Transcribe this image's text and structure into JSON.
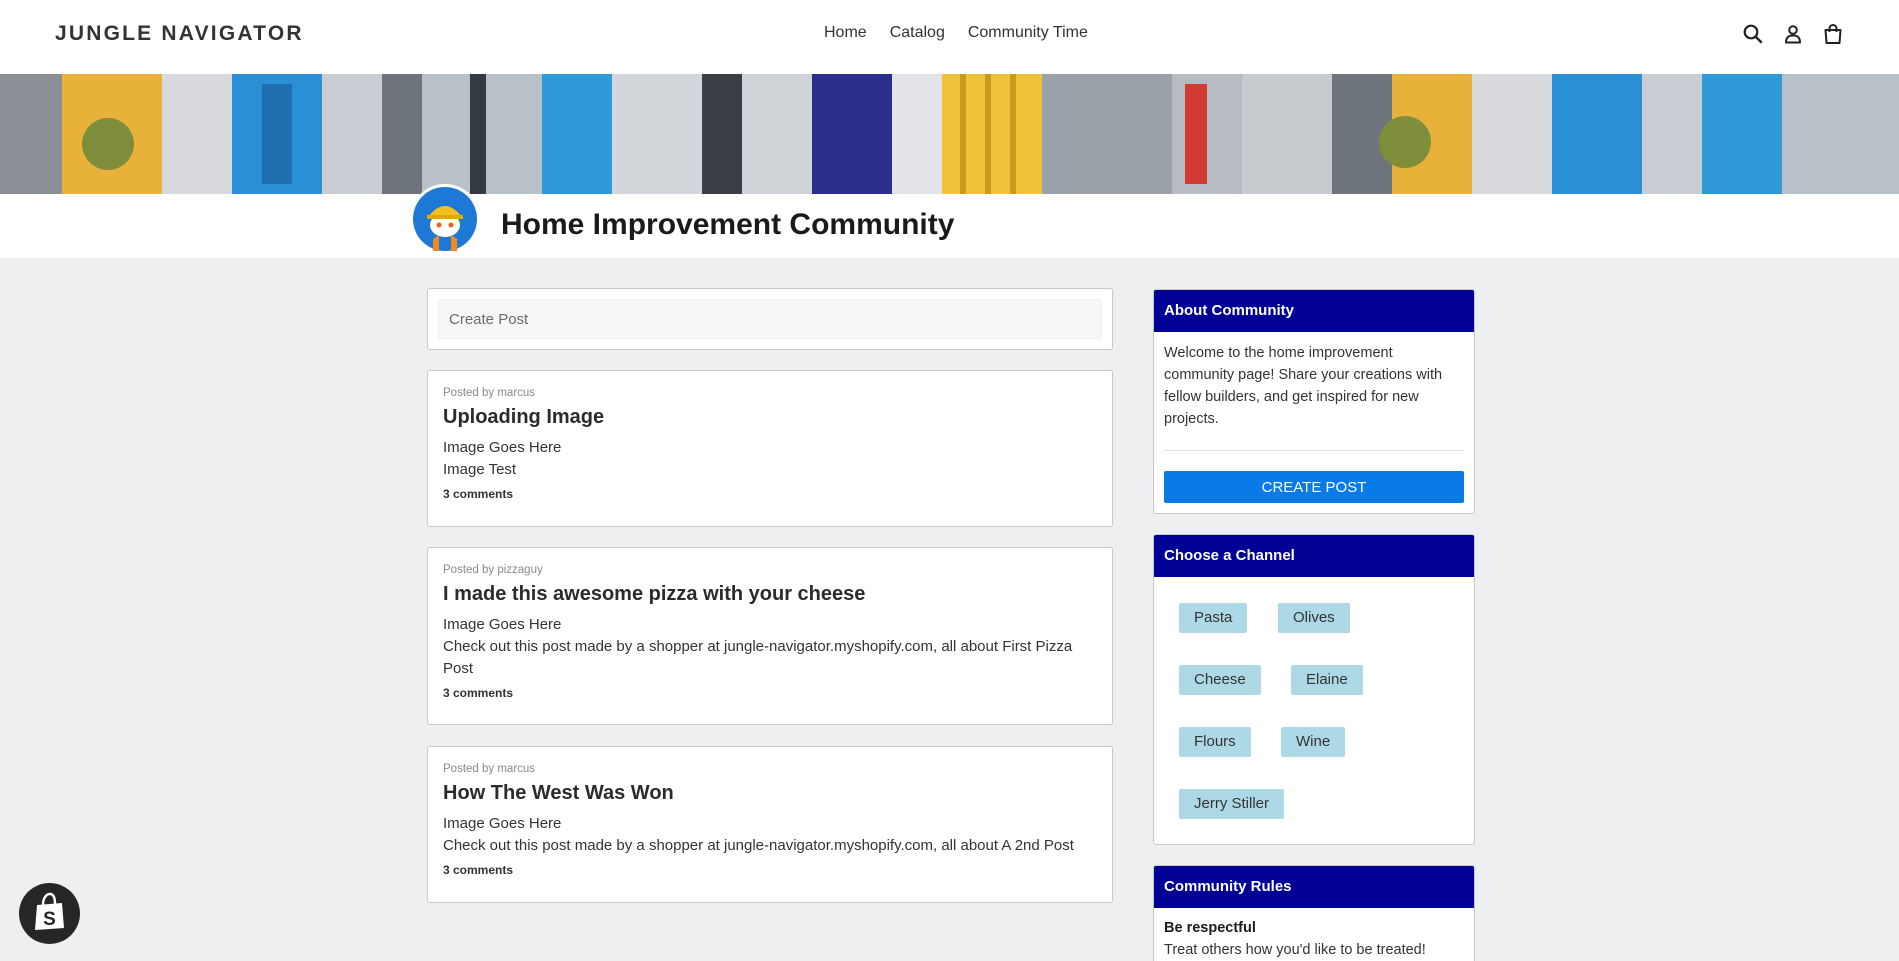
{
  "header": {
    "logo": "JUNGLE NAVIGATOR",
    "nav": [
      "Home",
      "Catalog",
      "Community Time"
    ],
    "icons": [
      "search-icon",
      "account-icon",
      "cart-icon"
    ]
  },
  "community": {
    "title": "Home Improvement Community"
  },
  "create_post": {
    "placeholder": "Create Post"
  },
  "posts": [
    {
      "meta": "Posted by marcus",
      "title": "Uploading Image",
      "body": [
        "Image Goes Here",
        "Image Test"
      ],
      "comments": "3 comments"
    },
    {
      "meta": "Posted by pizzaguy",
      "title": "I made this awesome pizza with your cheese",
      "body": [
        "Image Goes Here",
        "Check out this post made by a shopper at jungle-navigator.myshopify.com, all about First Pizza Post"
      ],
      "comments": "3 comments"
    },
    {
      "meta": "Posted by marcus",
      "title": "How The West Was Won",
      "body": [
        "Image Goes Here",
        "Check out this post made by a shopper at jungle-navigator.myshopify.com, all about A 2nd Post"
      ],
      "comments": "3 comments"
    }
  ],
  "sidebar": {
    "about": {
      "heading": "About Community",
      "text": "Welcome to the home improvement community page! Share your creations with fellow builders, and get inspired for new projects.",
      "button": "CREATE POST"
    },
    "channels": {
      "heading": "Choose a Channel",
      "items": [
        "Pasta",
        "Olives",
        "Cheese",
        "Elaine",
        "Flours",
        "Wine",
        "Jerry Stiller"
      ]
    },
    "rules": {
      "heading": "Community Rules",
      "items": [
        {
          "title": "Be respectful",
          "text": "Treat others how you'd like to be treated!"
        }
      ]
    }
  },
  "colors": {
    "sidebar_header": "#000096",
    "button": "#0a7ae6",
    "chip": "#add8e6",
    "page_bg": "#edeff1"
  }
}
